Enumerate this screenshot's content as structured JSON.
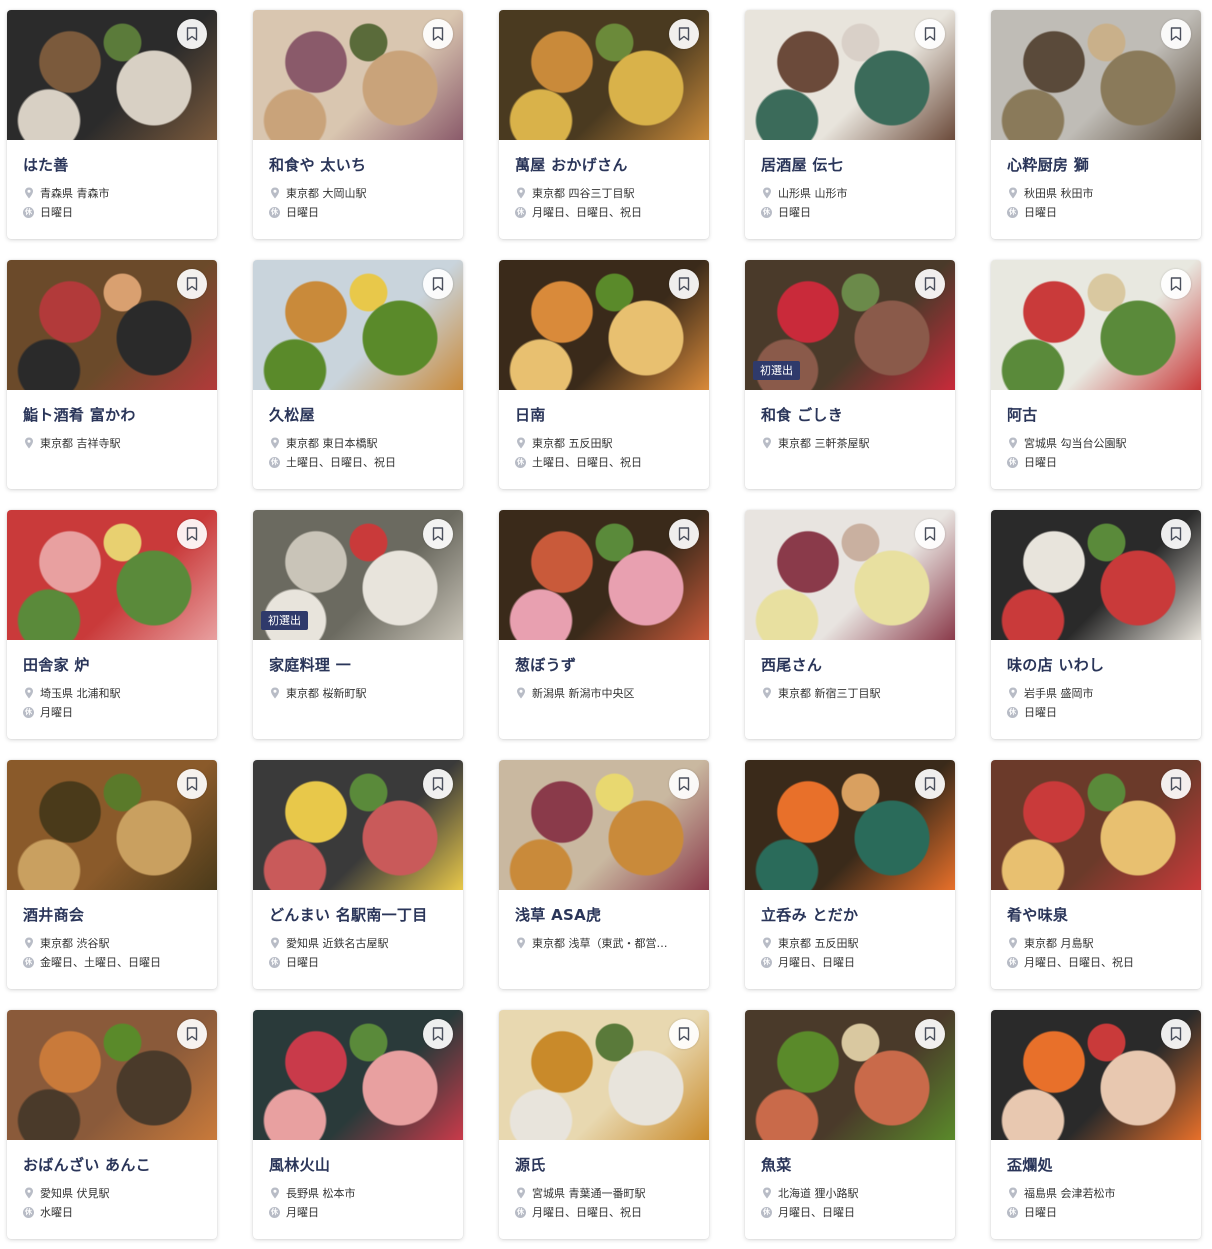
{
  "cards": [
    {
      "name": "はた善",
      "location": "青森県 青森市",
      "holiday": "日曜日",
      "badge": "",
      "colors": [
        "#2b2b2b",
        "#7b5a3c",
        "#d8d0c4",
        "#5b7b3a"
      ]
    },
    {
      "name": "和食や 太いち",
      "location": "東京都 大岡山駅",
      "holiday": "日曜日",
      "badge": "",
      "colors": [
        "#d9c6b0",
        "#8a5a6a",
        "#c9a37a",
        "#5a6b3a"
      ]
    },
    {
      "name": "萬屋 おかげさん",
      "location": "東京都 四谷三丁目駅",
      "holiday": "月曜日、日曜日、祝日",
      "badge": "",
      "colors": [
        "#4a3a20",
        "#c98a3a",
        "#d9b24a",
        "#6b8a3a"
      ]
    },
    {
      "name": "居酒屋 伝七",
      "location": "山形県 山形市",
      "holiday": "日曜日",
      "badge": "",
      "colors": [
        "#e8e4dc",
        "#6b4a3a",
        "#3b6b5a",
        "#d9d0c8"
      ]
    },
    {
      "name": "心粋厨房 獅",
      "location": "秋田県 秋田市",
      "holiday": "日曜日",
      "badge": "",
      "colors": [
        "#bfbcb6",
        "#5a4a3a",
        "#8a7a5a",
        "#c9b08a"
      ]
    },
    {
      "name": "鮨ト酒肴 富かわ",
      "location": "東京都 吉祥寺駅",
      "holiday": "",
      "badge": "",
      "colors": [
        "#6b4a2a",
        "#b23a3a",
        "#2a2a2a",
        "#d9a070"
      ]
    },
    {
      "name": "久松屋",
      "location": "東京都 東日本橋駅",
      "holiday": "土曜日、日曜日、祝日",
      "badge": "",
      "colors": [
        "#c9d4dc",
        "#c98a3a",
        "#5a8a2a",
        "#e8c84a"
      ]
    },
    {
      "name": "日南",
      "location": "東京都 五反田駅",
      "holiday": "土曜日、日曜日、祝日",
      "badge": "",
      "colors": [
        "#3a2a1a",
        "#d98a3a",
        "#e8c070",
        "#5a8a2a"
      ]
    },
    {
      "name": "和食 ごしき",
      "location": "東京都 三軒茶屋駅",
      "holiday": "",
      "badge": "初選出",
      "colors": [
        "#4a3a2a",
        "#c92a3a",
        "#8a5a4a",
        "#6b8a4a"
      ]
    },
    {
      "name": "阿古",
      "location": "宮城県 勾当台公園駅",
      "holiday": "日曜日",
      "badge": "",
      "colors": [
        "#e8e8e0",
        "#c93a3a",
        "#5a8a3a",
        "#d9c8a0"
      ]
    },
    {
      "name": "田舎家 炉",
      "location": "埼玉県 北浦和駅",
      "holiday": "月曜日",
      "badge": "",
      "colors": [
        "#c93a3a",
        "#e8a0a0",
        "#5a8a3a",
        "#e8d070"
      ]
    },
    {
      "name": "家庭料理 一",
      "location": "東京都 桜新町駅",
      "holiday": "",
      "badge": "初選出",
      "colors": [
        "#6b6a60",
        "#c9c4b8",
        "#e8e4dc",
        "#c93a3a"
      ]
    },
    {
      "name": "葱ぼうず",
      "location": "新潟県 新潟市中央区",
      "holiday": "",
      "badge": "",
      "colors": [
        "#3a2a1a",
        "#c95a3a",
        "#e8a0b0",
        "#5a8a3a"
      ]
    },
    {
      "name": "西尾さん",
      "location": "東京都 新宿三丁目駅",
      "holiday": "",
      "badge": "",
      "colors": [
        "#e8e4e0",
        "#8a3a4a",
        "#e8e0a0",
        "#c9b0a0"
      ]
    },
    {
      "name": "味の店 いわし",
      "location": "岩手県 盛岡市",
      "holiday": "日曜日",
      "badge": "",
      "colors": [
        "#2a2a2a",
        "#e8e4dc",
        "#c93a3a",
        "#5a8a3a"
      ]
    },
    {
      "name": "酒井商会",
      "location": "東京都 渋谷駅",
      "holiday": "金曜日、土曜日、日曜日",
      "badge": "",
      "colors": [
        "#8a5a2a",
        "#4a3a1a",
        "#c9a060",
        "#5a7a2a"
      ]
    },
    {
      "name": "どんまい 名駅南一丁目",
      "location": "愛知県 近鉄名古屋駅",
      "holiday": "日曜日",
      "badge": "",
      "colors": [
        "#3a3a3a",
        "#e8c84a",
        "#c95a5a",
        "#5a8a3a"
      ]
    },
    {
      "name": "浅草 ASA虎",
      "location": "東京都 浅草（東武・都営…",
      "holiday": "",
      "badge": "",
      "colors": [
        "#c9b8a0",
        "#8a3a4a",
        "#c98a3a",
        "#e8d870"
      ]
    },
    {
      "name": "立呑み とだか",
      "location": "東京都 五反田駅",
      "holiday": "月曜日、日曜日",
      "badge": "",
      "colors": [
        "#3a2a1a",
        "#e8702a",
        "#2a6b5a",
        "#d9a060"
      ]
    },
    {
      "name": "肴や味泉",
      "location": "東京都 月島駅",
      "holiday": "月曜日、日曜日、祝日",
      "badge": "",
      "colors": [
        "#6b3a2a",
        "#c93a3a",
        "#e8c070",
        "#5a8a3a"
      ]
    },
    {
      "name": "おばんざい あんこ",
      "location": "愛知県 伏見駅",
      "holiday": "水曜日",
      "badge": "",
      "colors": [
        "#8a5a3a",
        "#c97a3a",
        "#4a3a2a",
        "#5a8a2a"
      ]
    },
    {
      "name": "風林火山",
      "location": "長野県 松本市",
      "holiday": "月曜日",
      "badge": "",
      "colors": [
        "#2a3a3a",
        "#c93a4a",
        "#e8a0a0",
        "#5a8a3a"
      ]
    },
    {
      "name": "源氏",
      "location": "宮城県 青葉通一番町駅",
      "holiday": "月曜日、日曜日、祝日",
      "badge": "",
      "colors": [
        "#e8d8b0",
        "#c98a2a",
        "#e8e4dc",
        "#5a7a3a"
      ]
    },
    {
      "name": "魚菜",
      "location": "北海道 狸小路駅",
      "holiday": "月曜日、日曜日",
      "badge": "",
      "colors": [
        "#4a3a2a",
        "#5a8a2a",
        "#c96a4a",
        "#d9c8a0"
      ]
    },
    {
      "name": "盃爛処",
      "location": "福島県 会津若松市",
      "holiday": "日曜日",
      "badge": "",
      "colors": [
        "#2a2a2a",
        "#e8702a",
        "#e8c8b0",
        "#c93a3a"
      ]
    }
  ],
  "icons": {
    "location": "map-pin-icon",
    "holiday": "holiday-icon",
    "bookmark": "bookmark-icon",
    "holiday_glyph": "休"
  },
  "colors": {
    "name_text": "#2a3559",
    "badge_bg": "#2f3a6b",
    "icon_grey": "#b8bcc6"
  }
}
